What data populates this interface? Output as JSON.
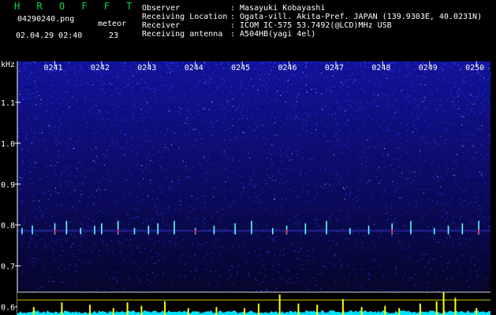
{
  "header": {
    "brand": "H R O F F T",
    "filename": "04290240.png",
    "meteor_label": "meteor",
    "datetime": "02.04.29 02:40",
    "meteor_count": "23",
    "info": [
      {
        "key": "Observer",
        "value": ": Masayuki Kobayashi"
      },
      {
        "key": "Receiving Location",
        "value": ": Ogata-vill. Akita-Pref. JAPAN (139.9303E, 40.0231N)"
      },
      {
        "key": "Receiver",
        "value": ": ICOM IC-575 53.7492(@LCD)MHz USB"
      },
      {
        "key": "Receiving antenna",
        "value": ": A504HB(yagi 4el)"
      }
    ]
  },
  "colors": {
    "background": "#000000",
    "spectrogram_bg": "#0a0a5a",
    "noise_dot": "#3a3aff",
    "echo_cyan": "#66ffff",
    "echo_red": "#ff3030",
    "meter_yellow": "#ffff00",
    "meter_cyan": "#00e5ff",
    "brand_green": "#00dd44"
  },
  "chart_data": {
    "type": "heatmap",
    "ylabel": "kHz",
    "y_ticks": [
      0.6,
      0.7,
      0.8,
      0.9,
      1.0,
      1.1
    ],
    "y_tick_labels": [
      "0.6",
      "0.7",
      "0.8",
      "0.9",
      "1.0",
      "1.1"
    ],
    "ylim": [
      0.58,
      1.2
    ],
    "x_ticks": [
      "0241",
      "0242",
      "0243",
      "0244",
      "0245",
      "0246",
      "0247",
      "0248",
      "0249",
      "0250"
    ],
    "x_tick_minutes": [
      1,
      2,
      3,
      4,
      5,
      6,
      7,
      8,
      9,
      10
    ],
    "xlim_minutes": [
      0.2,
      10.3
    ],
    "echo_frequency_khz": 0.785,
    "echo_minutes": [
      0.3,
      0.52,
      1.0,
      1.25,
      1.55,
      1.85,
      2.0,
      2.35,
      2.7,
      3.0,
      3.2,
      3.55,
      4.0,
      4.4,
      4.85,
      5.2,
      5.65,
      5.95,
      6.35,
      6.8,
      7.3,
      7.7,
      8.2,
      8.6,
      9.1,
      9.4,
      9.7,
      10.05
    ],
    "meter_minutes": [
      0.55,
      1.15,
      1.75,
      2.25,
      2.55,
      2.85,
      3.35,
      3.85,
      4.45,
      5.05,
      5.35,
      5.8,
      6.2,
      6.6,
      7.15,
      7.55,
      8.05,
      8.35,
      8.8,
      9.15,
      9.3,
      9.55,
      10.0
    ],
    "meter_heights": [
      0.35,
      0.55,
      0.45,
      0.3,
      0.55,
      0.4,
      0.6,
      0.3,
      0.35,
      0.3,
      0.5,
      0.9,
      0.5,
      0.45,
      0.7,
      0.35,
      0.4,
      0.3,
      0.5,
      0.6,
      1.0,
      0.75,
      0.3
    ]
  }
}
